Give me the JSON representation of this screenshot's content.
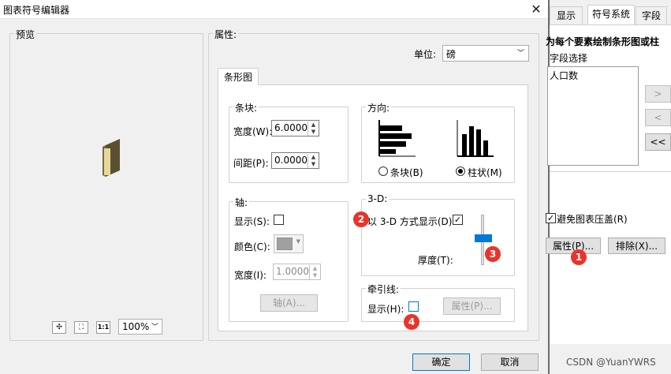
{
  "window": {
    "title": "图表符号编辑器",
    "close_glyph": "✕"
  },
  "preview": {
    "label": "预览",
    "zoom": "100%",
    "tool_1to1": "1:1"
  },
  "properties": {
    "label": "属性:",
    "unit_label": "单位:",
    "unit_value": "磅",
    "tab": "条形图",
    "bar_group": {
      "label": "条块:",
      "width_label": "宽度(W):",
      "width_value": "6.0000",
      "spacing_label": "间距(P):",
      "spacing_value": "0.0000"
    },
    "direction_group": {
      "label": "方向:",
      "bar_option": "条块(B)",
      "column_option": "柱状(M)"
    },
    "axis_group": {
      "label": "轴:",
      "show_label": "显示(S):",
      "color_label": "颜色(C):",
      "width_label": "宽度(I):",
      "width_value": "1.0000",
      "axis_button": "轴(A)..."
    },
    "threed_group": {
      "label": "3-D:",
      "show_label": "以 3-D 方式显示(D):",
      "thickness_label": "厚度(T):"
    },
    "leader_group": {
      "label": "牵引线:",
      "show_label": "显示(H):",
      "props_button": "属性(P)..."
    }
  },
  "footer": {
    "ok": "确定",
    "cancel": "取消"
  },
  "right": {
    "tabs": [
      "显示",
      "符号系统",
      "字段"
    ],
    "header": "为每个要素绘制条形图或柱",
    "field_select_label": "字段选择",
    "fields": [
      "人口数"
    ],
    "move_buttons": [
      ">",
      "<",
      "<<"
    ],
    "avoid_overlap_label": "避免图表压盖(R)",
    "props_button": "属性(P)...",
    "exclude_button": "排除(X)...",
    "watermark": "CSDN @YuanYWRS"
  },
  "markers": [
    "1",
    "2",
    "3",
    "4"
  ],
  "colors": {
    "marker": "#e8342b",
    "accent": "#0078d7"
  }
}
